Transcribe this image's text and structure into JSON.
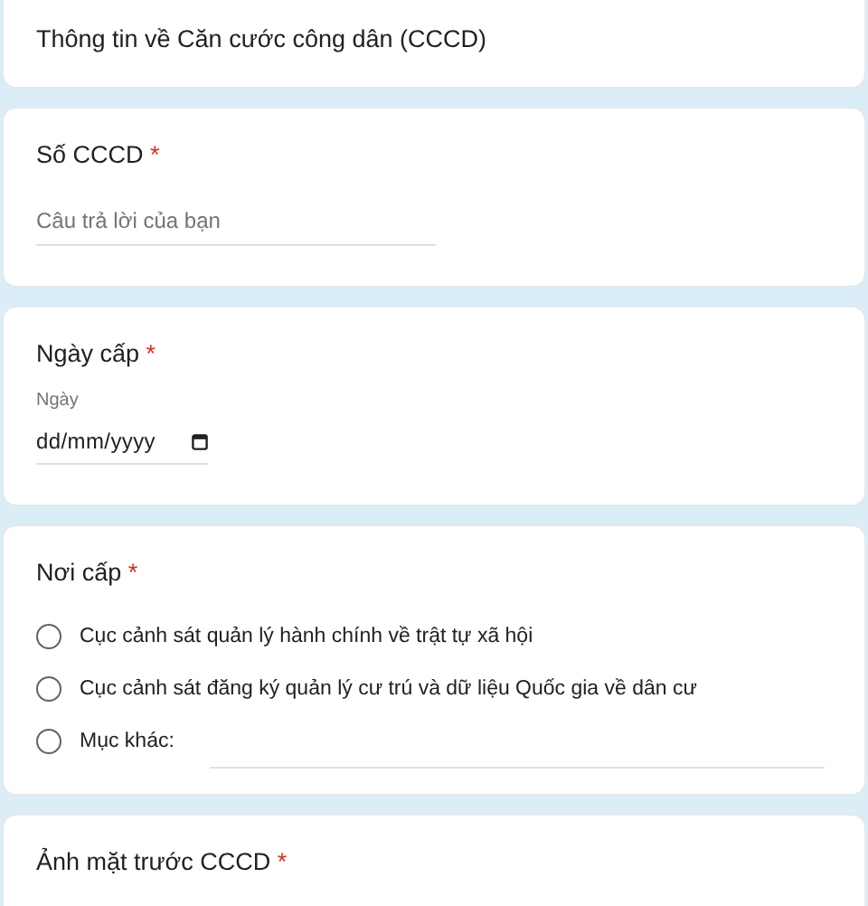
{
  "section_title": "Thông tin về Căn cước công dân (CCCD)",
  "questions": [
    {
      "kind": "text",
      "title": "Số CCCD",
      "required": true,
      "placeholder": "Câu trả lời của bạn"
    },
    {
      "kind": "date",
      "title": "Ngày cấp",
      "required": true,
      "sublabel": "Ngày",
      "placeholder": "dd/mm/yyyy"
    },
    {
      "kind": "radio",
      "title": "Nơi cấp",
      "required": true,
      "options": [
        {
          "label": "Cục cảnh sát quản lý hành chính về trật tự xã hội",
          "selected": false
        },
        {
          "label": "Cục cảnh sát đăng ký quản lý cư trú và dữ liệu Quốc gia về dân cư",
          "selected": false
        },
        {
          "label": "Mục khác:",
          "selected": false,
          "other": true
        }
      ]
    },
    {
      "kind": "upload",
      "title": "Ảnh mặt trước CCCD",
      "required": true
    }
  ],
  "required_mark": "*"
}
